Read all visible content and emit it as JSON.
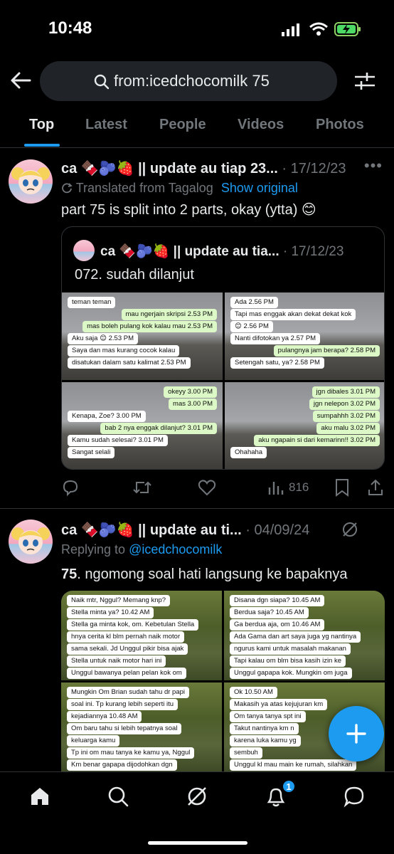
{
  "status_bar": {
    "time": "10:48"
  },
  "search": {
    "query": "from:icedchocomilk 75"
  },
  "tabs": [
    "Top",
    "Latest",
    "People",
    "Videos",
    "Photos"
  ],
  "active_tab": "Top",
  "posts": [
    {
      "author": "ca 🍫🫐🍓 || update au tiap 23...",
      "date": "· 17/12/23",
      "translated": "Translated from Tagalog",
      "show_original": "Show original",
      "text": "part 75 is split into 2 parts, okay (ytta) 😊",
      "quote": {
        "author": "ca 🍫🫐🍓 || update au tia...",
        "date": "· 17/12/23",
        "text": "072. sudah dilanjut",
        "images": [
          [
            {
              "t": "teman teman",
              "k": "in"
            },
            {
              "t": "mau ngerjain skripsi   2.53 PM",
              "k": "out"
            },
            {
              "t": "mas boleh pulang kok kalau mau   2.53 PM",
              "k": "out"
            },
            {
              "t": "Aku saja 😊   2.53 PM",
              "k": "in"
            },
            {
              "t": "Saya dan mas kurang cocok kalau",
              "k": "in"
            },
            {
              "t": "disatukan dalam satu kalimat   2.53 PM",
              "k": "in"
            }
          ],
          [
            {
              "t": "Ada   2.56 PM",
              "k": "in"
            },
            {
              "t": "Tapi mas enggak akan dekat dekat kok",
              "k": "in"
            },
            {
              "t": "😊   2.56 PM",
              "k": "in"
            },
            {
              "t": "Nanti difotokan ya   2.57 PM",
              "k": "in"
            },
            {
              "t": "pulangnya jam berapa?   2.58 PM",
              "k": "out"
            },
            {
              "t": "Setengah satu, ya?   2.58 PM",
              "k": "in"
            }
          ],
          [
            {
              "t": "okeyy   3.00 PM",
              "k": "out"
            },
            {
              "t": "mas   3.00 PM",
              "k": "out"
            },
            {
              "t": "Kenapa, Zoe?   3.00 PM",
              "k": "in"
            },
            {
              "t": "bab 2 nya enggak dilanjut?   3.01 PM",
              "k": "out"
            },
            {
              "t": "Kamu sudah selesai?   3.01 PM",
              "k": "in"
            },
            {
              "t": "Sangat selali",
              "k": "in"
            }
          ],
          [
            {
              "t": "jgn dibales   3.01 PM",
              "k": "out"
            },
            {
              "t": "jgn nelepon   3.02 PM",
              "k": "out"
            },
            {
              "t": "sumpahhh   3.02 PM",
              "k": "out"
            },
            {
              "t": "aku malu   3.02 PM",
              "k": "out"
            },
            {
              "t": "aku ngapain si dari kemarinn!!   3.02 PM",
              "k": "out"
            },
            {
              "t": "Ohahaha",
              "k": "in"
            }
          ]
        ]
      },
      "actions": {
        "views": "816"
      }
    },
    {
      "author": "ca 🍫🫐🍓 || update au ti...",
      "date": "· 04/09/24",
      "replying_prefix": "Replying to ",
      "replying_to": "@icedchocomilk",
      "text_bold": "75",
      "text_rest": ". ngomong soal hati langsung ke bapaknya",
      "images": [
        [
          {
            "t": "Naik mtr, Nggul? Memang knp?",
            "k": "in"
          },
          {
            "t": "Stella minta ya?   10.42 AM",
            "k": "in"
          },
          {
            "t": "Stella ga minta kok, om. Kebetulan Stella",
            "k": "in"
          },
          {
            "t": "hnya cerita kl blm pernah naik motor",
            "k": "in"
          },
          {
            "t": "sama sekali. Jd Unggul pikir bisa ajak",
            "k": "in"
          },
          {
            "t": "Stella untuk naik motor hari ini",
            "k": "in"
          },
          {
            "t": "Unggul bawanya pelan pelan kok om",
            "k": "in"
          }
        ],
        [
          {
            "t": "Disana dgn siapa?   10.45 AM",
            "k": "in"
          },
          {
            "t": "Berdua saja?   10.45 AM",
            "k": "in"
          },
          {
            "t": "Ga berdua aja, om   10.46 AM",
            "k": "in"
          },
          {
            "t": "Ada Gama dan art saya juga yg nantinya",
            "k": "in"
          },
          {
            "t": "ngurus kami untuk masalah makanan",
            "k": "in"
          },
          {
            "t": "Tapi kalau om blm bisa kasih izin ke",
            "k": "in"
          },
          {
            "t": "Unggul gapapa kok. Mungkin om juga",
            "k": "in"
          }
        ],
        [
          {
            "t": "Mungkin Om Brian sudah tahu dr papi",
            "k": "in"
          },
          {
            "t": "soal ini. Tp kurang lebih seperti itu",
            "k": "in"
          },
          {
            "t": "kejadiannya   10.48 AM",
            "k": "in"
          },
          {
            "t": "Om baru tahu si lebih tepatnya soal",
            "k": "in"
          },
          {
            "t": "keluarga kamu",
            "k": "in"
          },
          {
            "t": "Tp ini om mau tanya ke kamu ya, Nggul",
            "k": "in"
          },
          {
            "t": "Km benar gapapa dijodohkan dgn",
            "k": "in"
          }
        ],
        [
          {
            "t": "Ok   10.50 AM",
            "k": "in"
          },
          {
            "t": "Makasih ya atas kejujuran km",
            "k": "in"
          },
          {
            "t": "Om tanya tanya spt ini",
            "k": "in"
          },
          {
            "t": "Takut nantinya km n",
            "k": "in"
          },
          {
            "t": "karena luka kamu yg",
            "k": "in"
          },
          {
            "t": "sembuh",
            "k": "in"
          },
          {
            "t": "Unggul kl mau main ke rumah, silahkan",
            "k": "in"
          }
        ]
      ]
    }
  ],
  "notifications_badge": "1",
  "colors": {
    "accent": "#1d9bf0",
    "background": "#000000",
    "muted": "#71767b",
    "text": "#e7e9ea"
  },
  "icons": [
    "back-arrow-icon",
    "search-icon",
    "filter-icon",
    "more-icon",
    "translate-icon",
    "reply-icon",
    "retweet-icon",
    "like-icon",
    "views-icon",
    "bookmark-icon",
    "share-icon",
    "mute-icon",
    "plus-icon",
    "home-icon",
    "explore-icon",
    "grok-icon",
    "notifications-icon",
    "messages-icon"
  ]
}
